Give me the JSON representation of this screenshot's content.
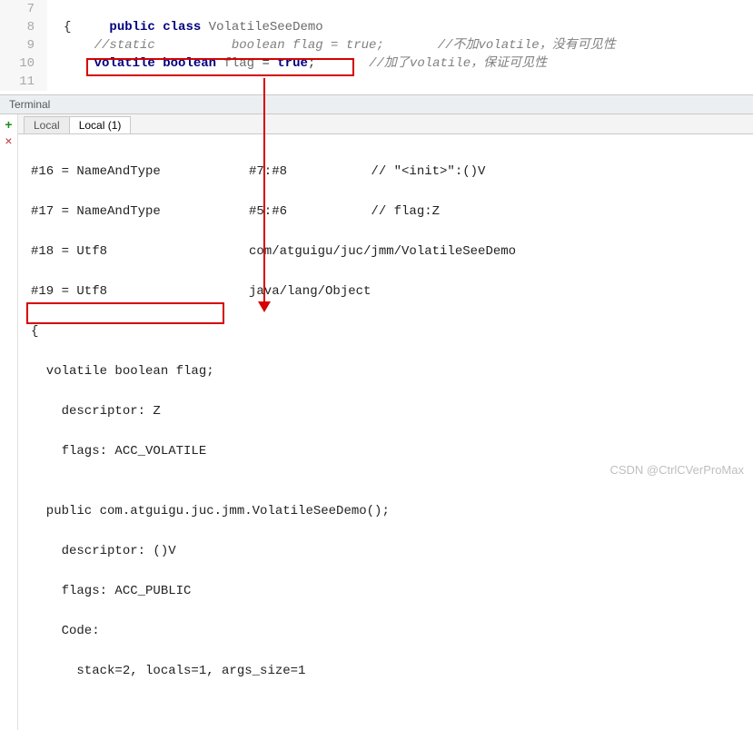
{
  "editor": {
    "lines": [
      {
        "n": "7",
        "tokens": [
          {
            "pre": "",
            "t": "public",
            "c": "kw-public"
          },
          {
            "pre": " ",
            "t": "class",
            "c": "kw-class"
          },
          {
            "pre": " ",
            "t": "VolatileSeeDemo",
            "c": "ident-dim"
          }
        ]
      },
      {
        "n": "8",
        "tokens": [
          {
            "pre": "",
            "t": "{",
            "c": "brace"
          }
        ]
      },
      {
        "n": "9",
        "tokens": [
          {
            "pre": "    ",
            "t": "//static          boolean flag = true;",
            "c": "comment"
          },
          {
            "pre": "       ",
            "t": "//不加volatile，没有可见性",
            "c": "comment-cn"
          }
        ]
      },
      {
        "n": "10",
        "tokens": [
          {
            "pre": "    ",
            "t": "volatile",
            "c": "kw-volatile"
          },
          {
            "pre": " ",
            "t": "boolean",
            "c": "kw-boolean"
          },
          {
            "pre": " ",
            "t": "flag",
            "c": "ident-dim"
          },
          {
            "pre": " ",
            "t": "=",
            "c": "ident"
          },
          {
            "pre": " ",
            "t": "true",
            "c": "kw-true"
          },
          {
            "pre": "",
            "t": ";",
            "c": "ident"
          },
          {
            "pre": "       ",
            "t": "//加了volatile，保证可见性",
            "c": "comment-cn"
          }
        ]
      },
      {
        "n": "11",
        "tokens": []
      }
    ]
  },
  "terminal": {
    "title": "Terminal",
    "tabs": [
      {
        "label": "Local",
        "active": false
      },
      {
        "label": "Local (1)",
        "active": true
      }
    ],
    "pool_rows": [
      {
        "left": "#16 = NameAndType",
        "right": "#7:#8           // \"<init>\":()V"
      },
      {
        "left": "#17 = NameAndType",
        "right": "#5:#6           // flag:Z"
      },
      {
        "left": "#18 = Utf8",
        "right": "com/atguigu/juc/jmm/VolatileSeeDemo"
      },
      {
        "left": "#19 = Utf8",
        "right": "java/lang/Object"
      }
    ],
    "body": [
      "{",
      "  volatile boolean flag;",
      "    descriptor: Z",
      "    flags: ACC_VOLATILE",
      "",
      "  public com.atguigu.juc.jmm.VolatileSeeDemo();",
      "    descriptor: ()V",
      "    flags: ACC_PUBLIC",
      "    Code:",
      "      stack=2, locals=1, args_size=1"
    ]
  },
  "watermark": "CSDN @CtrlCVerProMax"
}
